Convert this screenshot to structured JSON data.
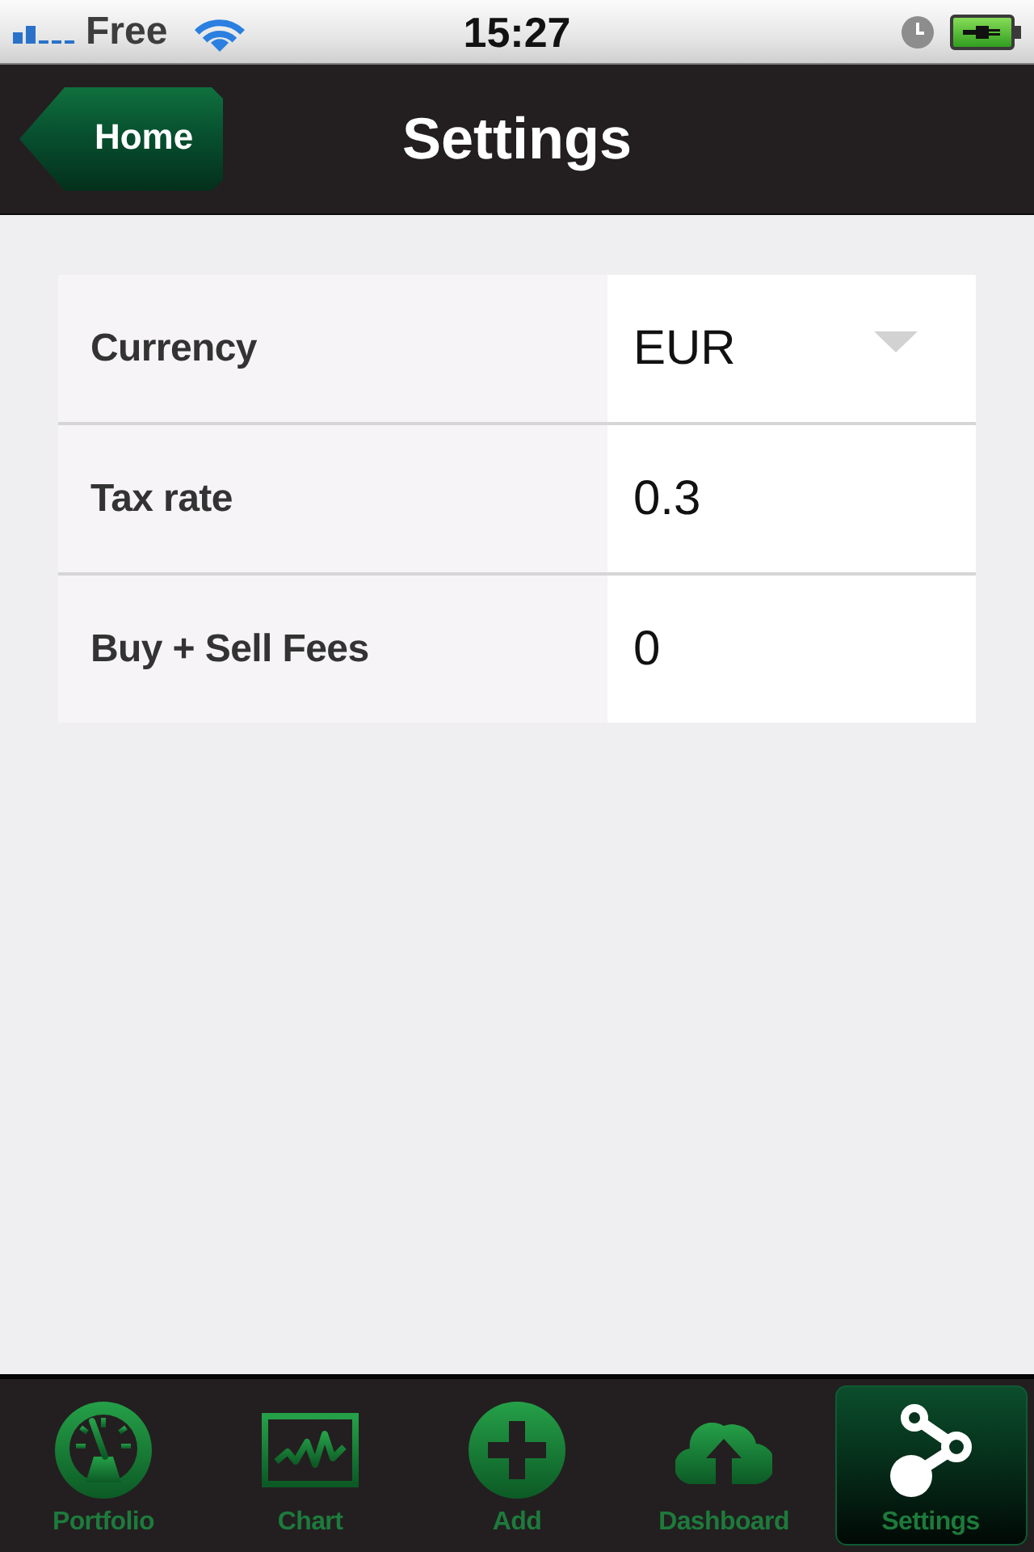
{
  "status_bar": {
    "carrier": "Free",
    "time": "15:27"
  },
  "nav_bar": {
    "back_button": "Home",
    "title": "Settings"
  },
  "settings": [
    {
      "kind": "dropdown",
      "label": "Currency",
      "value": "EUR"
    },
    {
      "kind": "input",
      "label": "Tax rate",
      "value": "0.3"
    },
    {
      "kind": "input",
      "label": "Buy + Sell Fees",
      "value": "0"
    }
  ],
  "tab_bar": {
    "tabs": [
      {
        "label": "Portfolio",
        "selected": false
      },
      {
        "label": "Chart",
        "selected": false
      },
      {
        "label": "Add",
        "selected": false
      },
      {
        "label": "Dashboard",
        "selected": false
      },
      {
        "label": "Settings",
        "selected": true
      }
    ]
  }
}
